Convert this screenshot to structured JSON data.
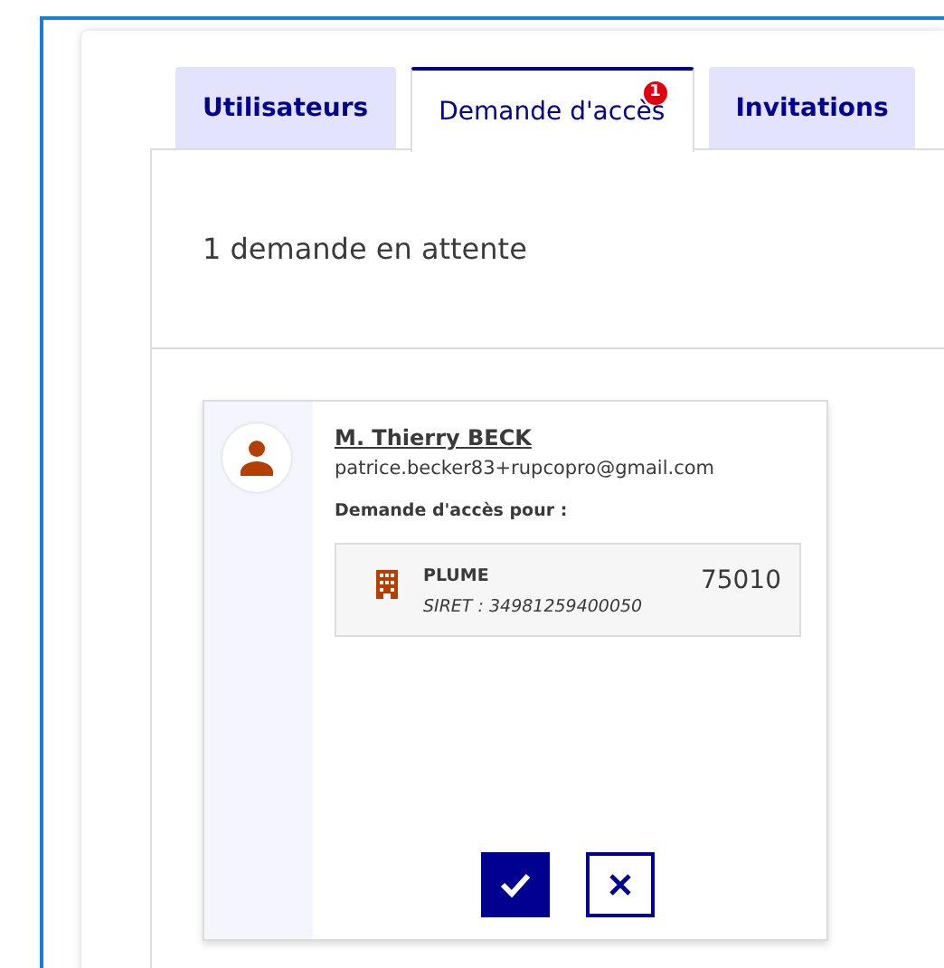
{
  "tabs": [
    {
      "label": "Utilisateurs",
      "selected": false
    },
    {
      "label": "Demande d'accès",
      "selected": true,
      "badge": "1"
    },
    {
      "label": "Invitations",
      "selected": false
    }
  ],
  "panel": {
    "heading": "1 demande en attente"
  },
  "requests": [
    {
      "name": "M. Thierry BECK",
      "email": "patrice.becker83+rupcopro@gmail.com",
      "access_label": "Demande d'accès pour :",
      "organization": {
        "name": "PLUME",
        "siret": "SIRET : 34981259400050",
        "postcode": "75010"
      }
    }
  ]
}
